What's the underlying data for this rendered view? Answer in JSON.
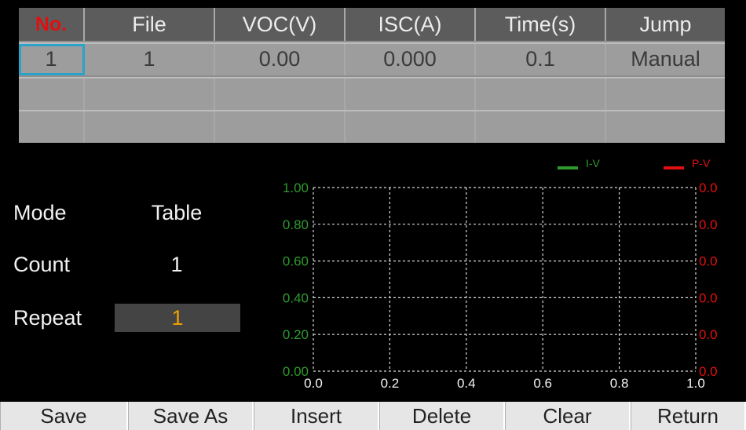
{
  "table": {
    "headers": [
      "No.",
      "File",
      "VOC(V)",
      "ISC(A)",
      "Time(s)",
      "Jump"
    ],
    "rows": [
      [
        "1",
        "1",
        "0.00",
        "0.000",
        "0.1",
        "Manual"
      ],
      [
        "",
        "",
        "",
        "",
        "",
        ""
      ],
      [
        "",
        "",
        "",
        "",
        "",
        ""
      ]
    ]
  },
  "params": {
    "mode_label": "Mode",
    "mode_value": "Table",
    "count_label": "Count",
    "count_value": "1",
    "repeat_label": "Repeat",
    "repeat_value": "1"
  },
  "chart_data": {
    "type": "line",
    "series": [
      {
        "name": "I-V",
        "color": "#2e9a2e",
        "values": []
      },
      {
        "name": "P-V",
        "color": "#e01010",
        "values": []
      }
    ],
    "x_ticks": [
      "0.0",
      "0.2",
      "0.4",
      "0.6",
      "0.8",
      "1.0"
    ],
    "y_left_ticks": [
      "1.00",
      "0.80",
      "0.60",
      "0.40",
      "0.20",
      "0.00"
    ],
    "y_right_ticks": [
      "0.0",
      "0.0",
      "0.0",
      "0.0",
      "0.0",
      "0.0"
    ],
    "xlim": [
      0,
      1.0
    ],
    "ylim": [
      0,
      1.0
    ],
    "grid": true,
    "legend_position": "top-right"
  },
  "buttons": [
    "Save",
    "Save As",
    "Insert",
    "Delete",
    "Clear",
    "Return"
  ]
}
